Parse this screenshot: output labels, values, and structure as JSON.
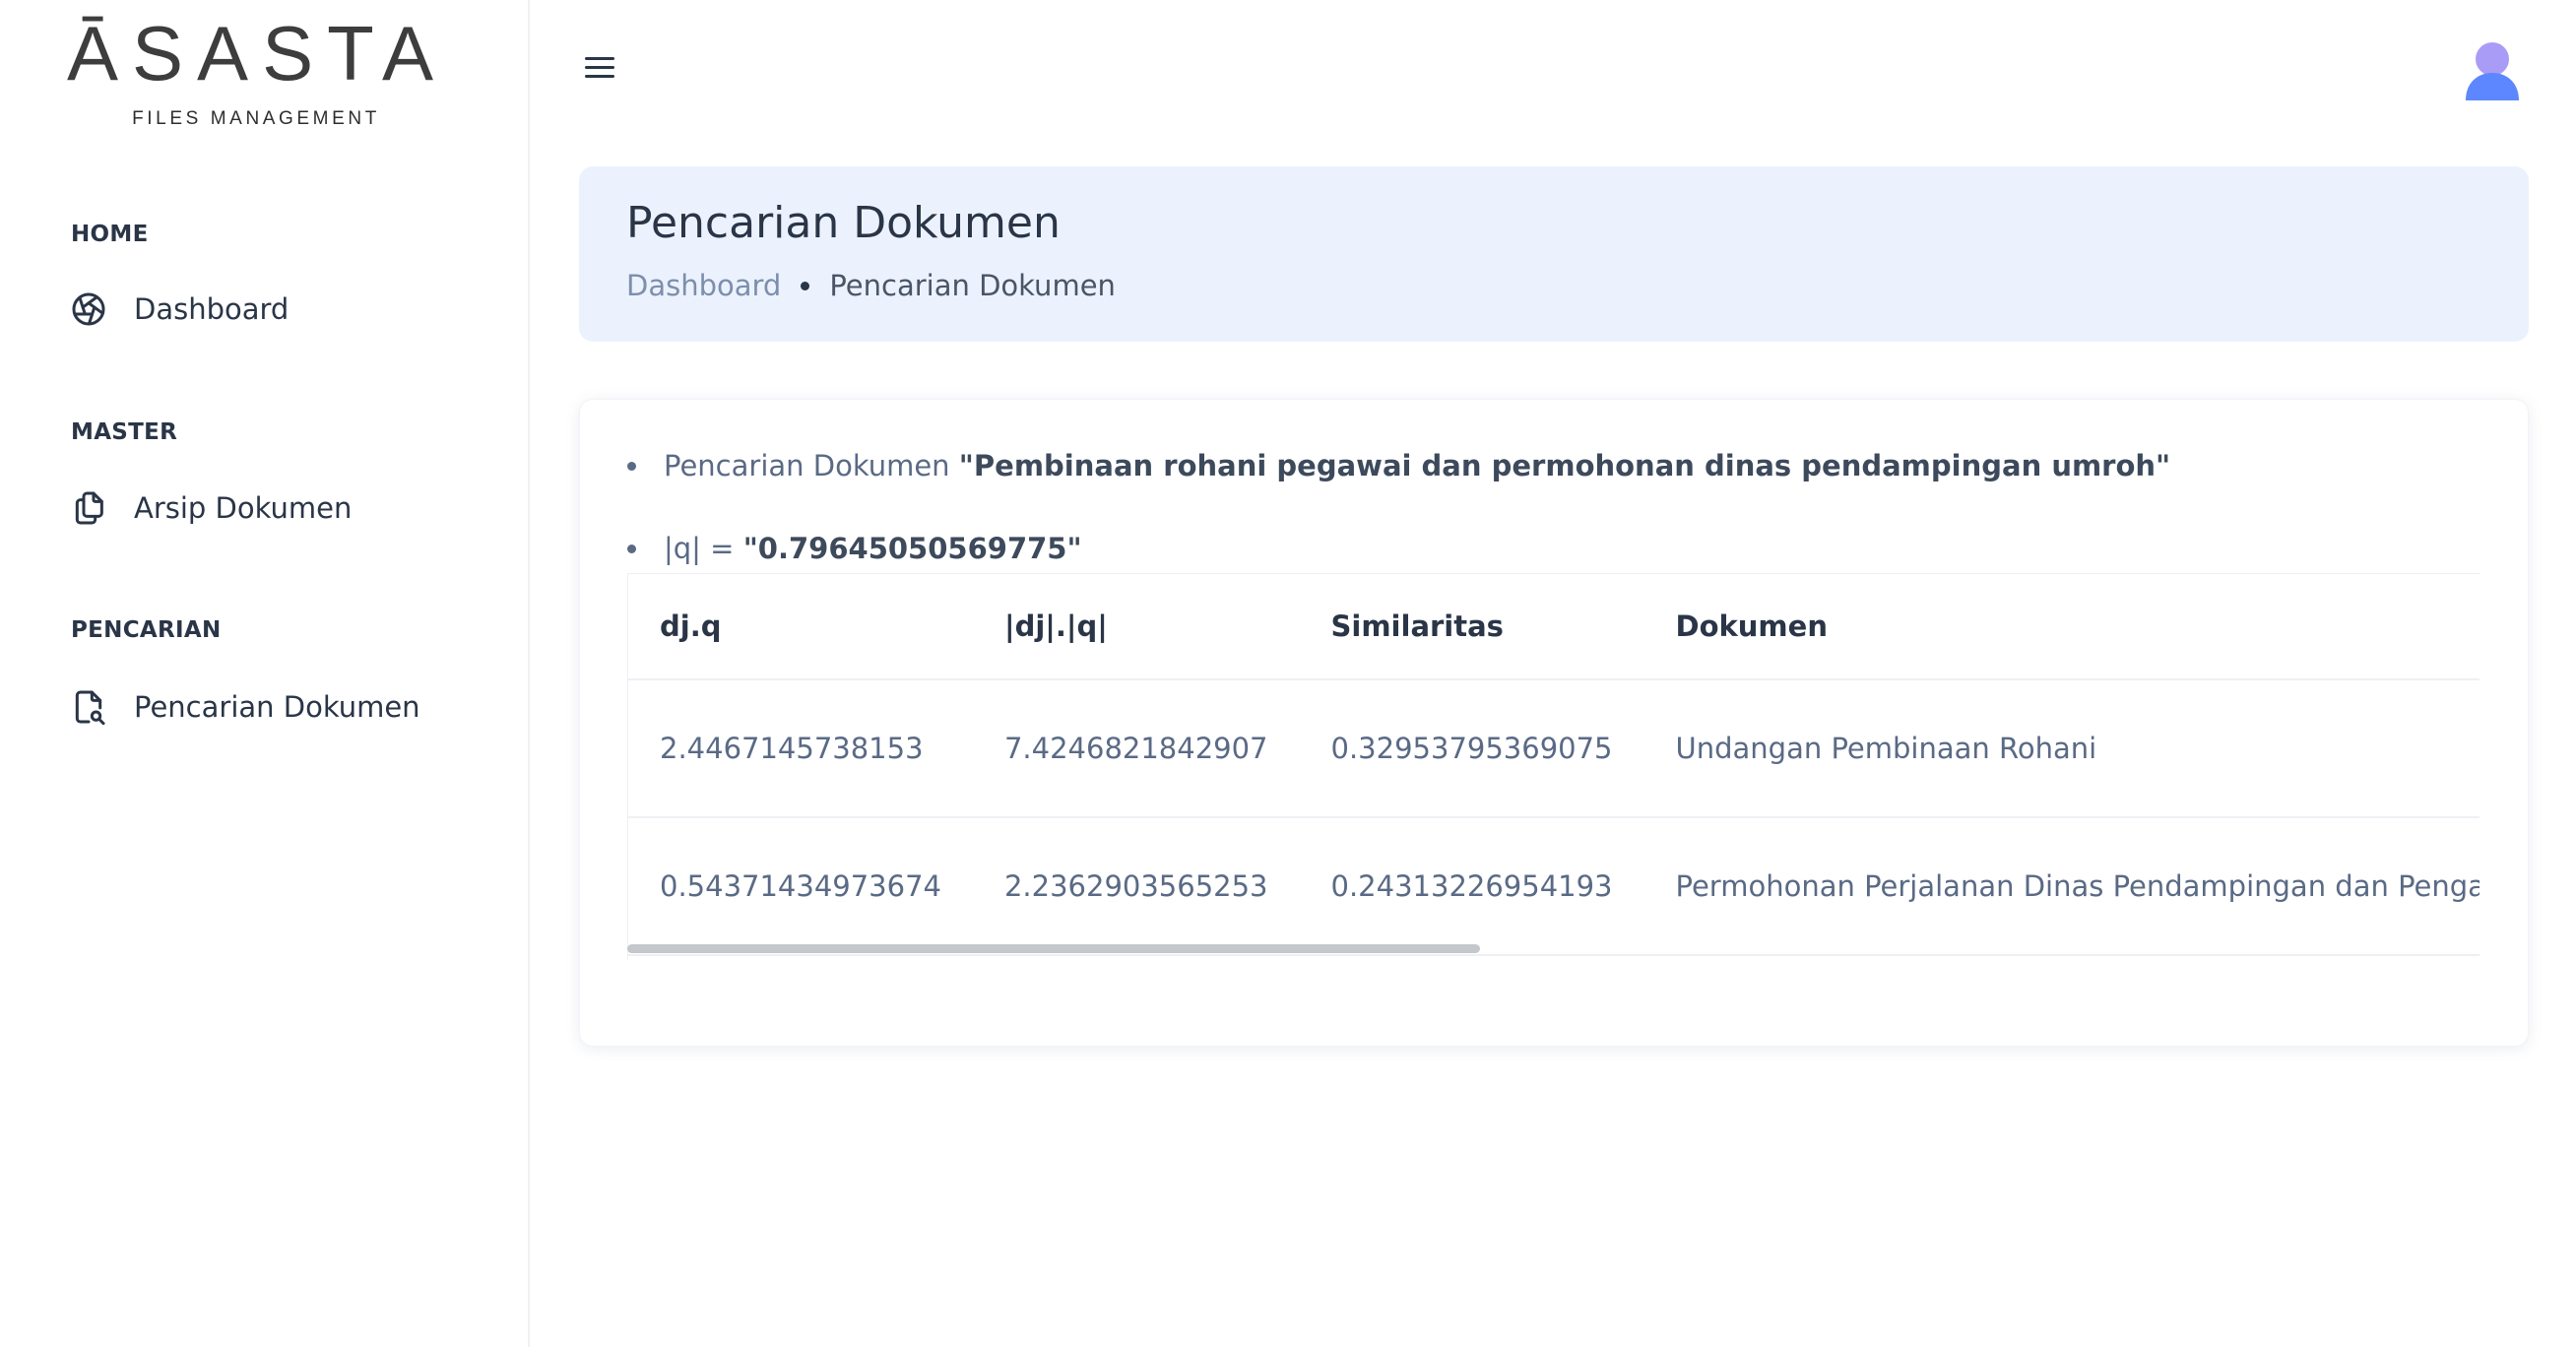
{
  "brand": {
    "name": "ĀSASTA",
    "tagline": "FILES MANAGEMENT"
  },
  "sidebar": {
    "sections": [
      {
        "caption": "HOME",
        "items": [
          {
            "label": "Dashboard",
            "icon": "aperture-icon"
          }
        ]
      },
      {
        "caption": "MASTER",
        "items": [
          {
            "label": "Arsip Dokumen",
            "icon": "copy-icon"
          }
        ]
      },
      {
        "caption": "PENCARIAN",
        "items": [
          {
            "label": "Pencarian Dokumen",
            "icon": "file-search-icon"
          }
        ]
      }
    ]
  },
  "topbar": {
    "menu_icon": "hamburger-icon",
    "avatar_icon": "user-avatar-icon"
  },
  "header": {
    "title": "Pencarian Dokumen",
    "breadcrumb": {
      "link": "Dashboard",
      "current": "Pencarian Dokumen"
    }
  },
  "search": {
    "query_label": "Pencarian Dokumen",
    "query_value": "\"Pembinaan rohani pegawai dan permohonan dinas pendampingan umroh\"",
    "norm_label": "|q| =",
    "norm_value": "\"0.79645050569775\""
  },
  "table": {
    "columns": [
      "dj.q",
      "|dj|.|q|",
      "Similaritas",
      "Dokumen"
    ],
    "rows": [
      [
        "2.4467145738153",
        "7.4246821842907",
        "0.32953795369075",
        "Undangan Pembinaan Rohani"
      ],
      [
        "0.54371434973674",
        "2.2362903565253",
        "0.24313226954193",
        "Permohonan Perjalanan Dinas Pendampingan dan Pengantaran Pegawai"
      ]
    ]
  },
  "colors": {
    "accent": "#5d87ff",
    "header_bg": "#ecf2fd",
    "text": "#2a3547",
    "muted": "#7c8fac"
  }
}
